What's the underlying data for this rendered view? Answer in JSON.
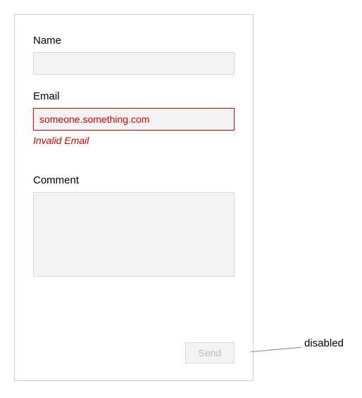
{
  "form": {
    "name": {
      "label": "Name",
      "value": ""
    },
    "email": {
      "label": "Email",
      "value": "someone.something.com",
      "error": "Invalid Email"
    },
    "comment": {
      "label": "Comment",
      "value": ""
    },
    "submit": {
      "label": "Send",
      "disabled": true
    }
  },
  "annotation": {
    "label": "disabled"
  }
}
